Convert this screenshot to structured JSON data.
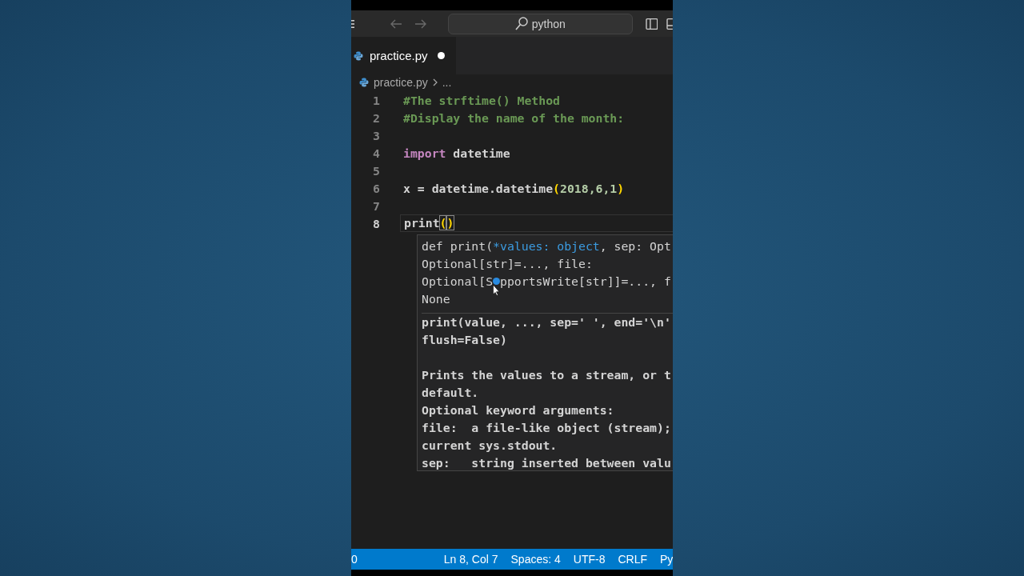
{
  "title_bar": {
    "nav_buttons": [
      {
        "kind": "back",
        "disabled": true
      },
      {
        "kind": "forward",
        "disabled": true
      }
    ],
    "search": "python"
  },
  "tabs": [
    {
      "label": "practice.py",
      "selected": true,
      "modified": true
    }
  ],
  "breadcrumb": [
    "practice.py",
    "..."
  ],
  "editor": {
    "lines": [
      {
        "number": "1",
        "active": false,
        "tokens": [
          {
            "text": "#The strftime() Method",
            "kind": "comment"
          }
        ]
      },
      {
        "number": "2",
        "active": false,
        "tokens": [
          {
            "text": "#Display the name of the month:",
            "kind": "comment"
          }
        ]
      },
      {
        "number": "3",
        "active": false
      },
      {
        "number": "4",
        "active": false,
        "tokens": [
          {
            "text": "import",
            "kind": "keyword"
          },
          {
            "text": " datetime",
            "kind": "plain"
          }
        ]
      },
      {
        "number": "5",
        "active": false
      },
      {
        "number": "6",
        "active": false,
        "tokens": [
          {
            "text": "x = datetime.datetime",
            "kind": "plain"
          },
          {
            "text": "(",
            "kind": "bracket"
          },
          {
            "text": "2018,6,1",
            "kind": "number"
          },
          {
            "text": ")",
            "kind": "bracket"
          }
        ]
      },
      {
        "number": "7",
        "active": false
      },
      {
        "number": "8",
        "active": true,
        "tokens": [
          {
            "text": "print",
            "kind": "plain"
          },
          {
            "text": "(",
            "kind": "bracket-match"
          },
          {
            "kind": "cursor"
          },
          {
            "text": ")",
            "kind": "bracket-match"
          }
        ]
      }
    ]
  },
  "hover": {
    "signature": [
      [
        {
          "text": "def print(",
          "kind": "plain"
        },
        {
          "text": "*values: object",
          "kind": "param"
        },
        {
          "text": ", sep: Opt",
          "kind": "plain"
        }
      ],
      [
        {
          "text": "Optional[str]=..., file:",
          "kind": "plain"
        }
      ],
      [
        {
          "text": "Optional[S",
          "kind": "plain"
        },
        {
          "kind": "gap"
        },
        {
          "text": "pportsWrite[str]]=..., f",
          "kind": "plain"
        }
      ],
      [
        {
          "text": "None",
          "kind": "plain"
        }
      ]
    ],
    "doc": [
      [
        "print(value, ..., sep=' ', end='\\n'",
        "flush=False)"
      ],
      [
        "Prints the values to a stream, or t",
        "default.",
        "Optional keyword arguments:",
        "file:  a file-like object (stream);",
        "current sys.stdout.",
        "sep:   string inserted between valu"
      ]
    ]
  },
  "status_bar": {
    "items": [
      "0",
      "Ln 8, Col 7",
      "Spaces: 4",
      "UTF-8",
      "CRLF",
      "Py"
    ]
  }
}
